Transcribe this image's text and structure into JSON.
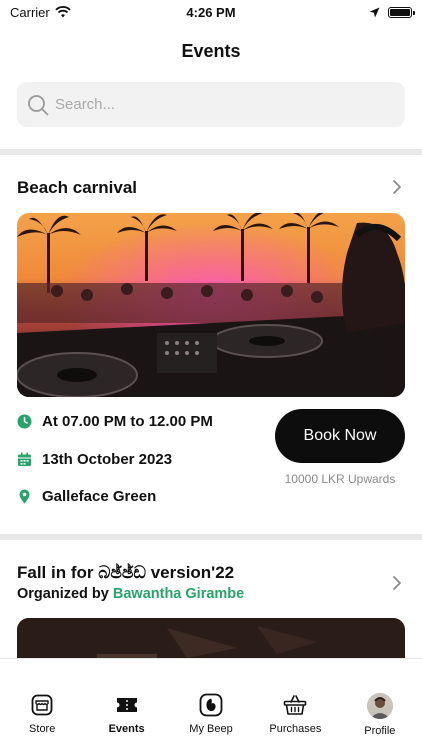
{
  "status_bar": {
    "carrier": "Carrier",
    "time": "4:26 PM"
  },
  "header": {
    "title": "Events"
  },
  "search": {
    "placeholder": "Search..."
  },
  "events": [
    {
      "title": "Beach carnival",
      "time": "At 07.00 PM to 12.00 PM",
      "date": "13th October 2023",
      "location": "Galleface Green",
      "book_label": "Book Now",
      "price": "10000 LKR Upwards"
    },
    {
      "title": "Fall in for බඡ්ඡ්ඩ version'22",
      "organizer_prefix": "Organized by",
      "organizer_name": "Bawantha Girambe"
    }
  ],
  "tabs": [
    {
      "label": "Store",
      "icon": "store-icon"
    },
    {
      "label": "Events",
      "icon": "ticket-icon",
      "active": true
    },
    {
      "label": "My Beep",
      "icon": "beep-icon"
    },
    {
      "label": "Purchases",
      "icon": "basket-icon"
    },
    {
      "label": "Profile",
      "icon": "avatar"
    }
  ],
  "colors": {
    "accent": "#2aa36b",
    "button": "#0d0d0d",
    "divider": "#e8e8e8"
  }
}
